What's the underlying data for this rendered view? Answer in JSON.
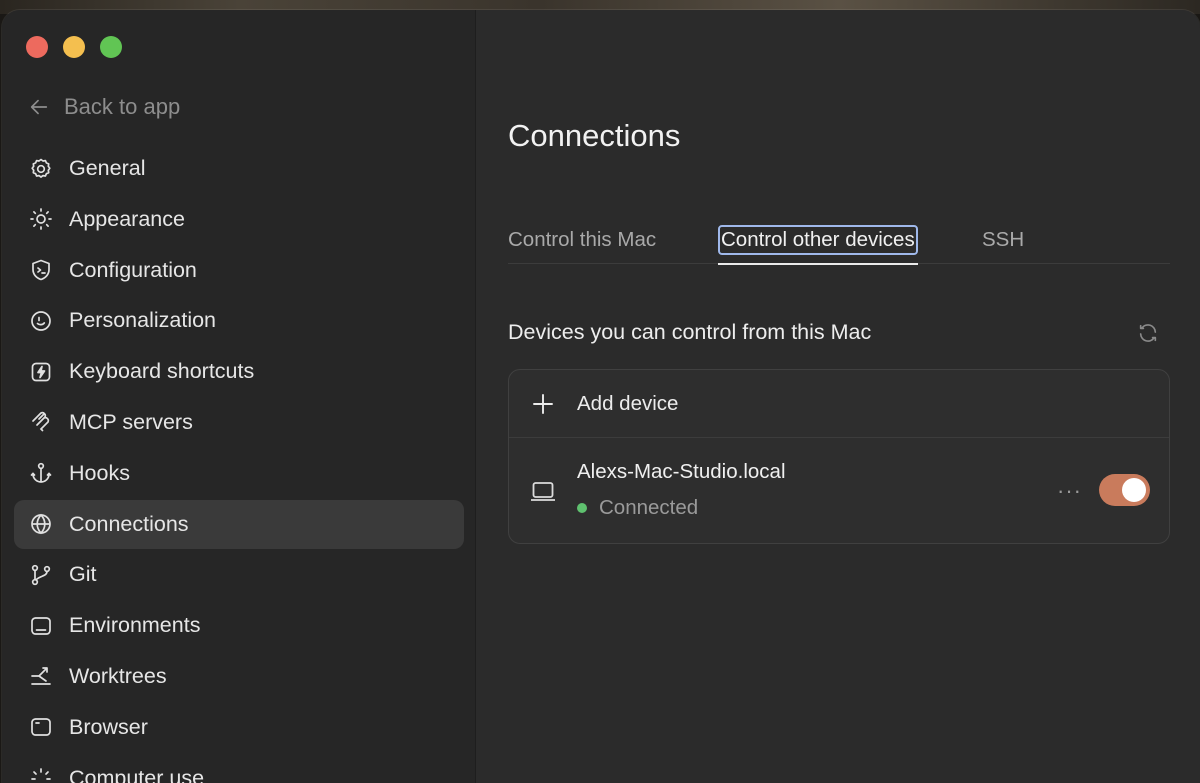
{
  "sidebar": {
    "back_label": "Back to app",
    "items": [
      {
        "label": "General",
        "icon": "gear-icon"
      },
      {
        "label": "Appearance",
        "icon": "sun-icon"
      },
      {
        "label": "Configuration",
        "icon": "shield-terminal-icon"
      },
      {
        "label": "Personalization",
        "icon": "smile-icon"
      },
      {
        "label": "Keyboard shortcuts",
        "icon": "bolt-key-icon"
      },
      {
        "label": "MCP servers",
        "icon": "mcp-icon"
      },
      {
        "label": "Hooks",
        "icon": "anchor-icon"
      },
      {
        "label": "Connections",
        "icon": "globe-icon",
        "active": true
      },
      {
        "label": "Git",
        "icon": "git-branch-icon"
      },
      {
        "label": "Environments",
        "icon": "monitor-icon"
      },
      {
        "label": "Worktrees",
        "icon": "worktree-icon"
      },
      {
        "label": "Browser",
        "icon": "browser-icon"
      },
      {
        "label": "Computer use",
        "icon": "computer-use-icon"
      }
    ]
  },
  "main": {
    "title": "Connections",
    "tabs": [
      "Control this Mac",
      "Control other devices",
      "SSH"
    ],
    "active_tab": "Control other devices",
    "section_title": "Devices you can control from this Mac",
    "add_device_label": "Add device",
    "device": {
      "name": "Alexs-Mac-Studio.local",
      "status": "Connected",
      "status_color": "#5fc16f",
      "enabled": true,
      "toggle_color": "#c97b5c"
    },
    "more_label": "···"
  }
}
